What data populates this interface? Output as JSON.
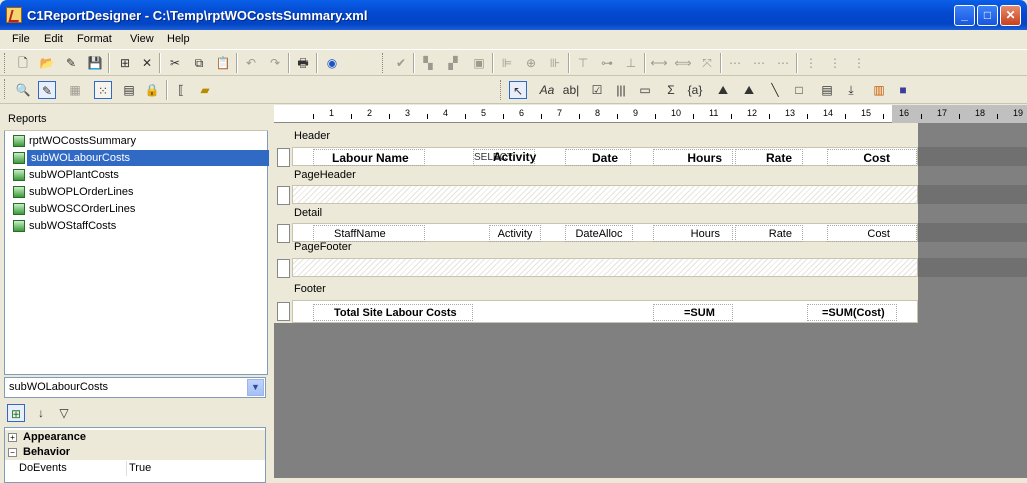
{
  "window": {
    "title": "C1ReportDesigner - C:\\Temp\\rptWOCostsSummary.xml",
    "minimize": "_",
    "maximize": "□",
    "close": "✕"
  },
  "menu": [
    "File",
    "Edit",
    "Format",
    "View",
    "Help"
  ],
  "reports_panel": {
    "header": "Reports",
    "items": [
      "rptWOCostsSummary",
      "subWOLabourCosts",
      "subWOPlantCosts",
      "subWOPLOrderLines",
      "subWOSCOrderLines",
      "subWOStaffCosts"
    ],
    "selected": "subWOLabourCosts"
  },
  "report_select": {
    "value": "subWOLabourCosts"
  },
  "properties": {
    "categories": [
      {
        "name": "Appearance",
        "expander": "+"
      },
      {
        "name": "Behavior",
        "expander": "−"
      }
    ],
    "rows": [
      {
        "name": "DoEvents",
        "value": "True"
      }
    ]
  },
  "ruler": [
    "1",
    "2",
    "3",
    "4",
    "5",
    "6",
    "7",
    "8",
    "9",
    "10",
    "11",
    "12",
    "13",
    "14",
    "15",
    "16",
    "17",
    "18",
    "19"
  ],
  "sections": {
    "header": {
      "label": "Header",
      "fields": {
        "labour_name": "Labour Name",
        "select_text": "SELECT",
        "activity": "Activity",
        "date": "Date",
        "hours": "Hours",
        "rate": "Rate",
        "cost": "Cost"
      }
    },
    "page_header": {
      "label": "PageHeader"
    },
    "detail": {
      "label": "Detail",
      "fields": {
        "staff_name": "StaffName",
        "activity": "Activity",
        "date_alloc": "DateAlloc",
        "hours": "Hours",
        "rate": "Rate",
        "cost": "Cost"
      }
    },
    "page_footer": {
      "label": "PageFooter"
    },
    "footer": {
      "label": "Footer",
      "fields": {
        "total_label": "Total Site Labour Costs",
        "sum_hours": "=SUM",
        "sum_cost": "=SUM(Cost)"
      }
    }
  },
  "colors": {
    "title_bar": "#0348cf",
    "selection": "#316ac5",
    "workspace": "#808080"
  }
}
